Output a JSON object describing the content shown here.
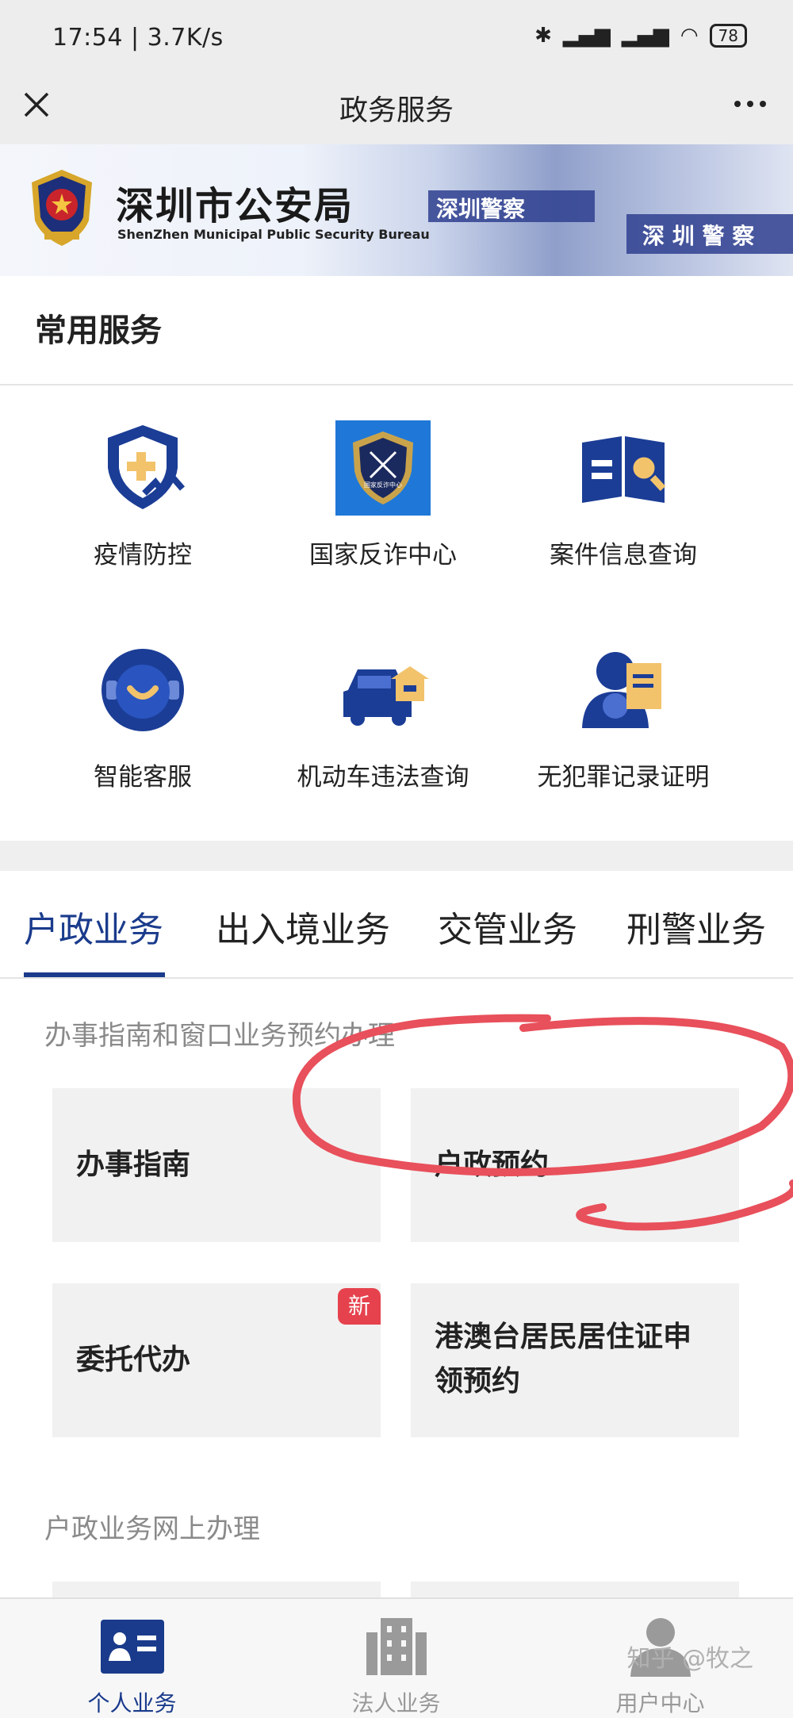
{
  "statusbar": {
    "time": "17:54 | 3.7K/s",
    "battery": "78"
  },
  "navbar": {
    "title": "政务服务"
  },
  "banner": {
    "name": "深圳市公安局",
    "subtitle": "ShenZhen Municipal Public Security Bureau",
    "stripe_text_1": "深圳警察",
    "stripe_text_2": "深 圳 警 察"
  },
  "common_services": {
    "title": "常用服务",
    "items": [
      {
        "label": "疫情防控",
        "icon": "shield-medical-icon"
      },
      {
        "label": "国家反诈中心",
        "icon": "anti-fraud-badge-icon",
        "badge_text": "国家反诈中心"
      },
      {
        "label": "案件信息查询",
        "icon": "book-search-icon"
      },
      {
        "label": "智能客服",
        "icon": "smiley-face-icon"
      },
      {
        "label": "机动车违法查询",
        "icon": "car-house-icon"
      },
      {
        "label": "无犯罪记录证明",
        "icon": "person-document-icon"
      }
    ]
  },
  "tabs": [
    {
      "label": "户政业务",
      "active": true
    },
    {
      "label": "出入境业务",
      "active": false
    },
    {
      "label": "交管业务",
      "active": false
    },
    {
      "label": "刑警业务",
      "active": false
    }
  ],
  "section1": {
    "heading": "办事指南和窗口业务预约办理",
    "cards": [
      {
        "label": "办事指南"
      },
      {
        "label": "户政预约"
      },
      {
        "label": "委托代办",
        "badge": "新"
      },
      {
        "label_line1": "港澳台居民居住证申",
        "label_line2": "领预约"
      }
    ]
  },
  "section2": {
    "heading": "户政业务网上办理"
  },
  "bottomnav": {
    "items": [
      {
        "label": "个人业务",
        "active": true
      },
      {
        "label": "法人业务",
        "active": false
      },
      {
        "label": "用户中心",
        "active": false
      }
    ]
  },
  "watermark": "知乎 @牧之",
  "colors": {
    "accent": "#1a3b8c",
    "icon_blue": "#1b3d96",
    "icon_gold": "#f2c36b",
    "badge_red": "#e5424d",
    "annotation_red": "#e8505b"
  }
}
